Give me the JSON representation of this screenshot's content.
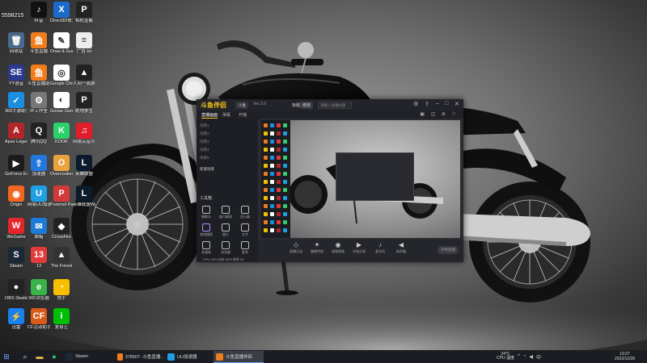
{
  "desktop": {
    "top_left_text": "5598215",
    "icons": [
      {
        "name": "tiktok",
        "label": "抖音",
        "color": "#111111",
        "glyph": "♪"
      },
      {
        "name": "xbox-tool",
        "label": "Direct3D修复工具",
        "color": "#1a6bcc",
        "glyph": "X"
      },
      {
        "name": "game-shortcut",
        "label": "相机宣解",
        "color": "#222222",
        "glyph": "P"
      },
      {
        "name": "recycle-bin",
        "label": "回收站",
        "color": "#4b6a8a",
        "glyph": "🗑"
      },
      {
        "name": "douyu-live",
        "label": "斗鱼直播",
        "color": "#f07c1c",
        "glyph": "鱼"
      },
      {
        "name": "draw-guess",
        "label": "Draw & Guess",
        "color": "#ffffff",
        "glyph": "✎"
      },
      {
        "name": "ad-txt",
        "label": "广告.txt",
        "color": "#eeeeee",
        "glyph": "≡"
      },
      {
        "name": "yy-voice",
        "label": "YY语音",
        "color": "#2b3a8f",
        "glyph": "SE"
      },
      {
        "name": "douyu-assist",
        "label": "斗鱼直播助手",
        "color": "#f07c1c",
        "glyph": "鱼"
      },
      {
        "name": "chrome",
        "label": "Google Chrome",
        "color": "#ffffff",
        "glyph": "◎"
      },
      {
        "name": "among-us",
        "label": "人间一周游戏",
        "color": "#222222",
        "glyph": "▲"
      },
      {
        "name": "360-assistant",
        "label": "360手游助手",
        "color": "#1a8fe0",
        "glyph": "✓"
      },
      {
        "name": "ip-tool",
        "label": "IP工作室",
        "color": "#777777",
        "glyph": "⚙"
      },
      {
        "name": "goose-goose-duck",
        "label": "Goose Goose Duck",
        "color": "#ffffff",
        "glyph": "◐"
      },
      {
        "name": "pubg",
        "label": "绝地求生",
        "color": "#222222",
        "glyph": "P"
      },
      {
        "name": "apex",
        "label": "Apex Legends",
        "color": "#b1262a",
        "glyph": "A"
      },
      {
        "name": "qq",
        "label": "腾讯QQ",
        "color": "#222222",
        "glyph": "Q"
      },
      {
        "name": "kook",
        "label": "KOOK",
        "color": "#2bd16b",
        "glyph": "K"
      },
      {
        "name": "netease-music",
        "label": "网易云音乐",
        "color": "#e11d2b",
        "glyph": "♫"
      },
      {
        "name": "geforce",
        "label": "GeForce Experience",
        "color": "#1b1b1b",
        "glyph": "▶"
      },
      {
        "name": "net-accel",
        "label": "加速器",
        "color": "#2277dd",
        "glyph": "⇧"
      },
      {
        "name": "overcooked",
        "label": "Overcooked! 2",
        "color": "#e8a33c",
        "glyph": "O"
      },
      {
        "name": "lol",
        "label": "英雄联盟",
        "color": "#0b1b2b",
        "glyph": "L"
      },
      {
        "name": "origin",
        "label": "Origin",
        "color": "#f26622",
        "glyph": "◉"
      },
      {
        "name": "netease-uu",
        "label": "网易UU加速器",
        "color": "#1f9fe6",
        "glyph": "U"
      },
      {
        "name": "pummel-party",
        "label": "Pummel Party",
        "color": "#d23a3a",
        "glyph": "P"
      },
      {
        "name": "lol-wegame",
        "label": "英雄联盟WeGame",
        "color": "#0b1b2b",
        "glyph": "L"
      },
      {
        "name": "wegame",
        "label": "WeGame",
        "color": "#e3262c",
        "glyph": "W"
      },
      {
        "name": "mail",
        "label": "邮箱",
        "color": "#1c7bd8",
        "glyph": "✉"
      },
      {
        "name": "crossfire",
        "label": "CrossFire",
        "color": "#222222",
        "glyph": "◆"
      },
      {
        "name": "steam",
        "label": "Steam",
        "color": "#1b2838",
        "glyph": "S"
      },
      {
        "name": "game-13",
        "label": "13",
        "color": "#e33a3a",
        "glyph": "13"
      },
      {
        "name": "dark-game",
        "label": "The Forest",
        "color": "#333333",
        "glyph": "▲"
      },
      {
        "name": "obs",
        "label": "OBS Studio",
        "color": "#222222",
        "glyph": "●"
      },
      {
        "name": "360-browser",
        "label": "360浏览器",
        "color": "#38b44a",
        "glyph": "e"
      },
      {
        "name": "kuaishou",
        "label": "快手",
        "color": "#f6c000",
        "glyph": "◔"
      },
      {
        "name": "thunder",
        "label": "迅雷",
        "color": "#1a7ff0",
        "glyph": "⚡"
      },
      {
        "name": "cf-helper",
        "label": "CF活动助手",
        "color": "#d95b1a",
        "glyph": "CF"
      },
      {
        "name": "iqiyi",
        "label": "爱奇艺",
        "color": "#00be06",
        "glyph": "i"
      }
    ]
  },
  "app": {
    "logo": "斗鱼伴侣",
    "badge": "斗鱼",
    "subtitle": "Ver 3.0",
    "title_caption": "标题",
    "title_button": "修改",
    "title_input_placeholder": "请输入直播标题",
    "tabs": [
      {
        "label": "直播画面",
        "active": true
      },
      {
        "label": "弹幕",
        "active": false
      },
      {
        "label": "开播",
        "active": false
      }
    ],
    "scenes": [
      "场景1",
      "场景2",
      "场景3",
      "场景4",
      "场景5"
    ],
    "scene_add_label": "新建场景",
    "tools_title": "工具箱",
    "tools": [
      {
        "name": "camera",
        "label": "摄像头"
      },
      {
        "name": "window",
        "label": "窗口捕获"
      },
      {
        "name": "display",
        "label": "显示器"
      },
      {
        "name": "game",
        "label": "游戏捕获"
      },
      {
        "name": "image",
        "label": "图片"
      },
      {
        "name": "text",
        "label": "文字"
      },
      {
        "name": "media",
        "label": "多媒体"
      },
      {
        "name": "browser",
        "label": "浏览器"
      },
      {
        "name": "more",
        "label": "更多"
      }
    ],
    "bottom_buttons": [
      {
        "name": "interact",
        "label": "直播互动",
        "glyph": "◇"
      },
      {
        "name": "effects",
        "label": "美颜特效",
        "glyph": "✦"
      },
      {
        "name": "record",
        "label": "录制视频",
        "glyph": "◉"
      },
      {
        "name": "share",
        "label": "开始分享",
        "glyph": "▶"
      },
      {
        "name": "mic",
        "label": "麦克风",
        "glyph": "♪"
      },
      {
        "name": "speaker",
        "label": "扬声器",
        "glyph": "◀"
      }
    ],
    "start_live_label": "开始直播",
    "status_text": "CPU 23%  内存 52%  帧率 60"
  },
  "taskbar": {
    "apps": [
      {
        "name": "steam",
        "label": "Steam",
        "color": "#1b2838",
        "active": false
      },
      {
        "name": "douyu-chat",
        "label": "378507 -斗鱼直播...",
        "color": "#f07c1c",
        "active": false
      },
      {
        "name": "uu",
        "label": "UU加速器",
        "color": "#1f9fe6",
        "active": false
      },
      {
        "name": "douyu-companion",
        "label": "斗鱼直播伴侣",
        "color": "#f07c1c",
        "active": true
      }
    ],
    "weather": {
      "temp": "24°C",
      "desc": "CPU 温度"
    },
    "tray_icons": [
      "up-arrow-icon",
      "network-icon",
      "volume-icon",
      "language-icon"
    ],
    "time": "19:27",
    "date": "2022/12/28"
  }
}
